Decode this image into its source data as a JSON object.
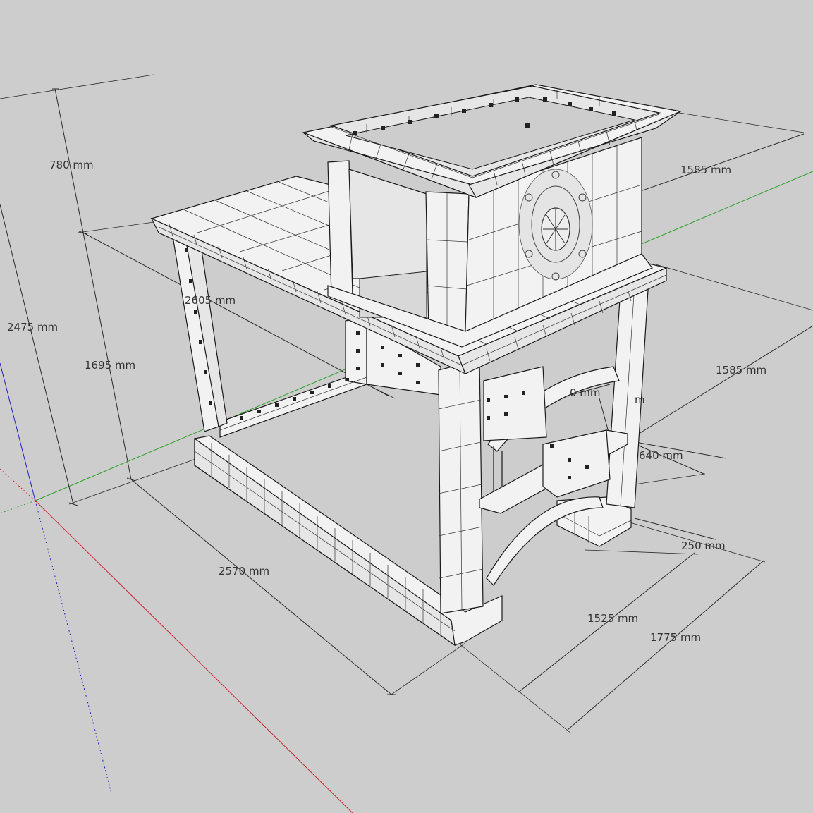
{
  "colors": {
    "background": "#cdcdcd",
    "axis_red": "#c8202a",
    "axis_green": "#2aa02a",
    "axis_blue": "#2020c0",
    "model_face": "#f2f2f2",
    "model_edge": "#1a1a1a"
  },
  "dimensions": {
    "d780": "780 mm",
    "d2475": "2475 mm",
    "d1695": "1695 mm",
    "d2605": "2605 mm",
    "d1585_top": "1585 mm",
    "d1585_mid": "1585 mm",
    "d640": "640 mm",
    "d250": "250 mm",
    "d2570": "2570 mm",
    "d1525": "1525 mm",
    "d1775": "1775 mm",
    "partial_mm_left": "0 mm",
    "partial_mm_right": "m"
  }
}
